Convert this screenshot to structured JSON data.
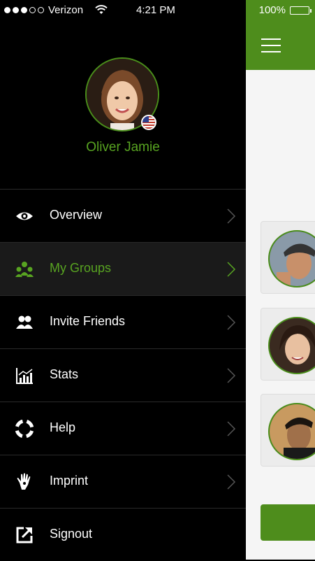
{
  "status_bar": {
    "carrier": "Verizon",
    "time": "4:21 PM",
    "battery": "100%",
    "signal_bars_filled": 3,
    "signal_bars_total": 5
  },
  "profile": {
    "name": "Oliver Jamie",
    "flag_icon": "us-flag-icon"
  },
  "menu": [
    {
      "label": "Overview",
      "icon": "eye-icon"
    },
    {
      "label": "My Groups",
      "icon": "groups-icon",
      "active": true
    },
    {
      "label": "Invite Friends",
      "icon": "friends-icon"
    },
    {
      "label": "Stats",
      "icon": "stats-icon"
    },
    {
      "label": "Help",
      "icon": "lifebuoy-icon"
    },
    {
      "label": "Imprint",
      "icon": "hand-icon"
    },
    {
      "label": "Signout",
      "icon": "external-link-icon"
    }
  ],
  "colors": {
    "accent": "#58a421",
    "topbar": "#4e8d1c",
    "drawer_bg": "#000000",
    "active_row_bg": "#1a1a1a"
  }
}
